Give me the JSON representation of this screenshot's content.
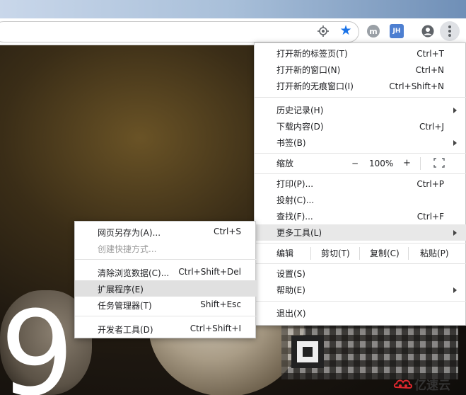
{
  "toolbar": {
    "ext_m_label": "m",
    "ext_jh_label": "JH"
  },
  "main_menu": {
    "new_tab": {
      "label": "打开新的标签页(T)",
      "shortcut": "Ctrl+T"
    },
    "new_window": {
      "label": "打开新的窗口(N)",
      "shortcut": "Ctrl+N"
    },
    "new_incognito": {
      "label": "打开新的无痕窗口(I)",
      "shortcut": "Ctrl+Shift+N"
    },
    "history": {
      "label": "历史记录(H)"
    },
    "downloads": {
      "label": "下载内容(D)",
      "shortcut": "Ctrl+J"
    },
    "bookmarks": {
      "label": "书签(B)"
    },
    "zoom": {
      "label": "缩放",
      "minus": "−",
      "value": "100%",
      "plus": "+"
    },
    "print": {
      "label": "打印(P)...",
      "shortcut": "Ctrl+P"
    },
    "cast": {
      "label": "投射(C)..."
    },
    "find": {
      "label": "查找(F)...",
      "shortcut": "Ctrl+F"
    },
    "more_tools": {
      "label": "更多工具(L)"
    },
    "edit": {
      "label": "编辑",
      "cut": "剪切(T)",
      "copy": "复制(C)",
      "paste": "粘贴(P)"
    },
    "settings": {
      "label": "设置(S)"
    },
    "help": {
      "label": "帮助(E)"
    },
    "exit": {
      "label": "退出(X)"
    }
  },
  "sub_menu": {
    "save_page": {
      "label": "网页另存为(A)...",
      "shortcut": "Ctrl+S"
    },
    "create_shortcut": {
      "label": "创建快捷方式..."
    },
    "clear_data": {
      "label": "清除浏览数据(C)...",
      "shortcut": "Ctrl+Shift+Del"
    },
    "extensions": {
      "label": "扩展程序(E)"
    },
    "task_manager": {
      "label": "任务管理器(T)",
      "shortcut": "Shift+Esc"
    },
    "dev_tools": {
      "label": "开发者工具(D)",
      "shortcut": "Ctrl+Shift+I"
    }
  },
  "background": {
    "big_number": "9"
  },
  "watermark": {
    "text": "亿速云"
  },
  "colors": {
    "accent": "#1a73e8",
    "highlight": "#e8e8e8"
  }
}
